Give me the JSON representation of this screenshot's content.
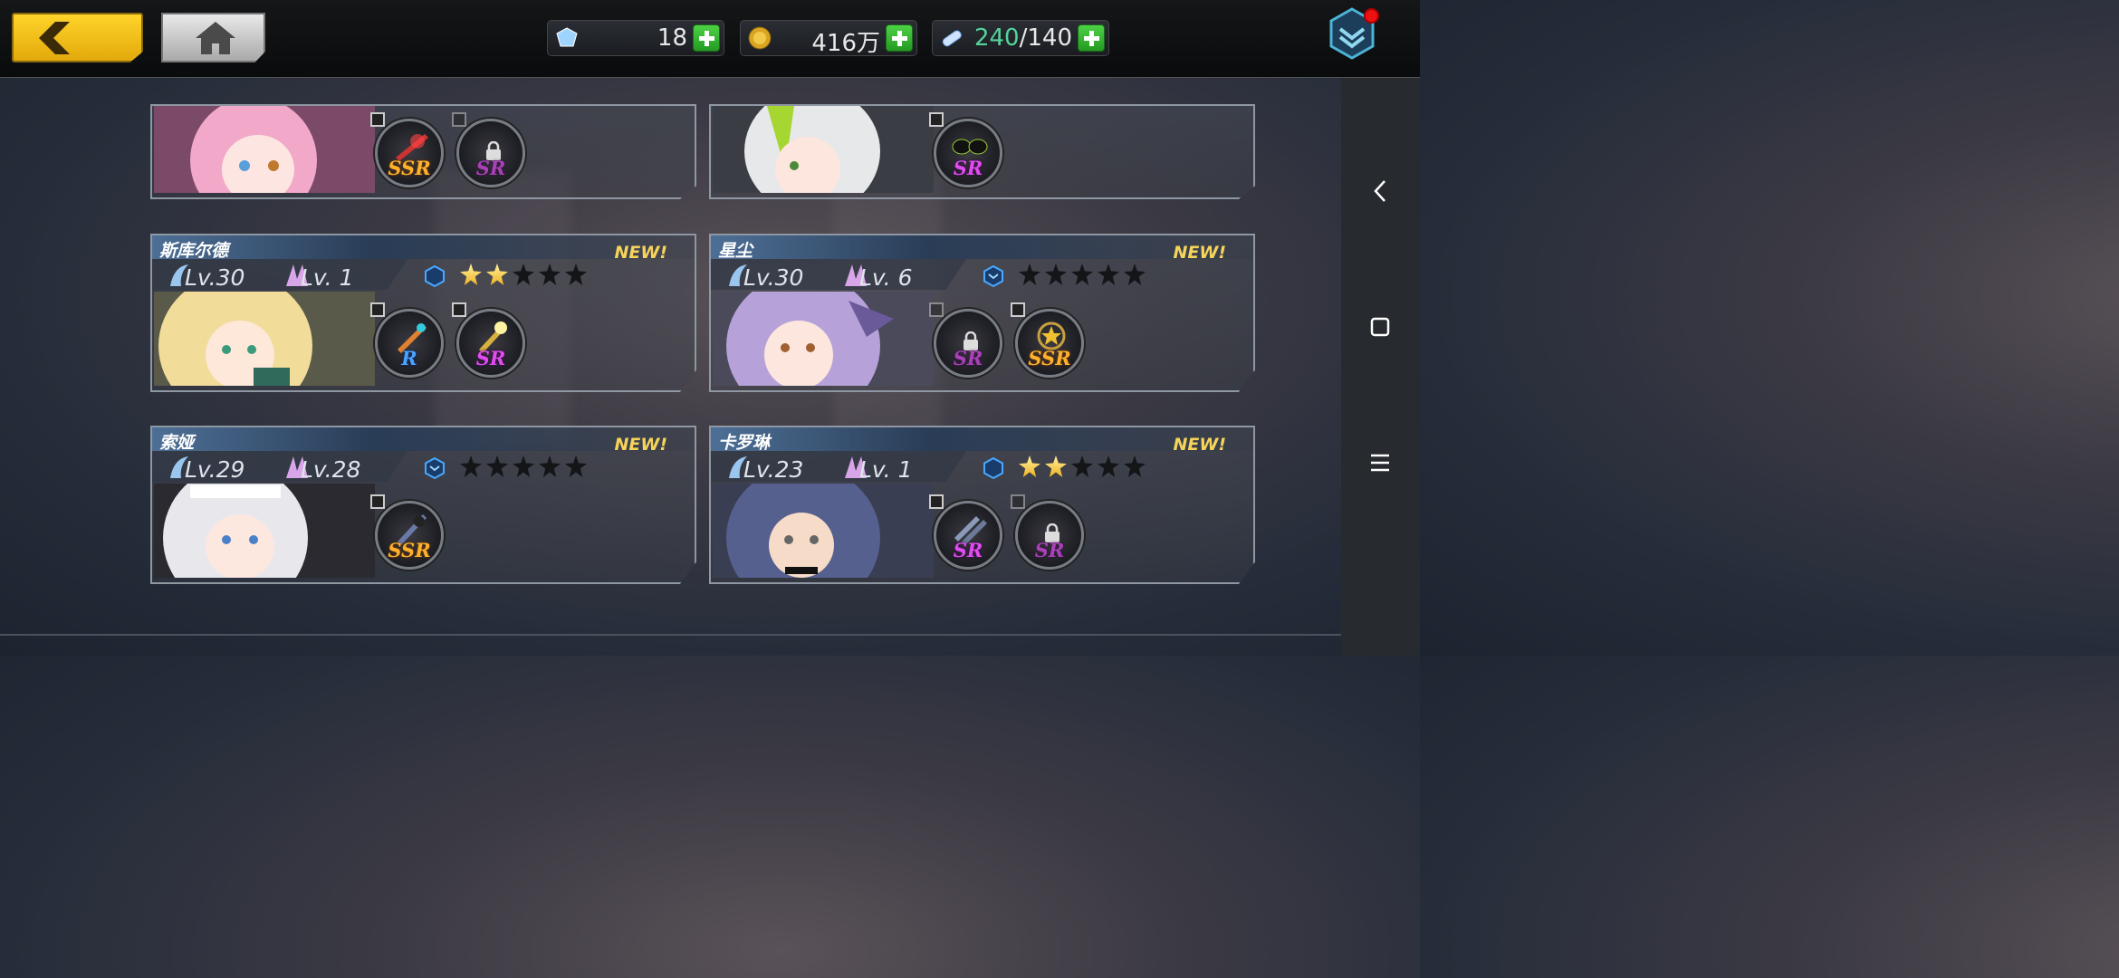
{
  "topbar": {
    "crystals": "18",
    "coins": "416万",
    "stamina_current": "240",
    "stamina_sep_max": "/140"
  },
  "colors": {
    "accent_gold": "#ffd42a",
    "plus_green": "#4ed246",
    "ssr": "#ffb12b",
    "sr": "#e04cf0",
    "r": "#4aa3ff",
    "new_tag": "#f6d35a"
  },
  "cards": [
    {
      "name": "",
      "new_tag": "",
      "slots": [
        {
          "rarity": "SSR",
          "locked": false
        },
        {
          "rarity": "SR",
          "locked": true
        }
      ]
    },
    {
      "name": "",
      "new_tag": "",
      "slots": [
        {
          "rarity": "SR",
          "locked": false
        }
      ]
    },
    {
      "name": "斯库尔德",
      "new_tag": "NEW!",
      "lv_prefix": "Lv.",
      "level": "30",
      "skill_level": "1",
      "stars": 2,
      "slots": [
        {
          "rarity": "R",
          "locked": false
        },
        {
          "rarity": "SR",
          "locked": false
        }
      ]
    },
    {
      "name": "星尘",
      "new_tag": "NEW!",
      "lv_prefix": "Lv.",
      "level": "30",
      "skill_level": "6",
      "stars": 0,
      "slots": [
        {
          "rarity": "SR",
          "locked": true
        },
        {
          "rarity": "SSR",
          "locked": false
        }
      ]
    },
    {
      "name": "索娅",
      "new_tag": "NEW!",
      "lv_prefix": "Lv.",
      "level": "29",
      "skill_level": "28",
      "stars": 0,
      "slots": [
        {
          "rarity": "SSR",
          "locked": false
        }
      ]
    },
    {
      "name": "卡罗琳",
      "new_tag": "NEW!",
      "lv_prefix": "Lv.",
      "level": "23",
      "skill_level": "1",
      "stars": 2,
      "slots": [
        {
          "rarity": "SR",
          "locked": false
        },
        {
          "rarity": "SR",
          "locked": true
        }
      ]
    }
  ],
  "nav": {
    "back": "back-icon",
    "home": "square-icon",
    "menu": "menu-icon"
  }
}
